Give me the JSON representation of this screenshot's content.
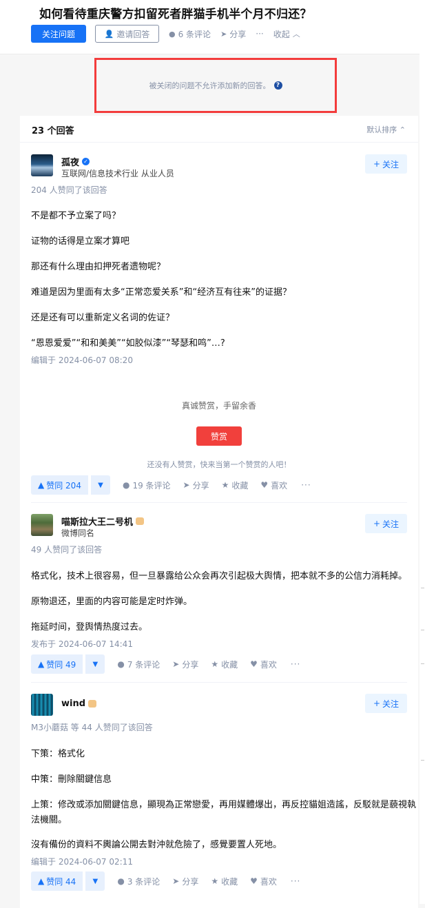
{
  "question": {
    "title": "如何看待重庆警方扣留死者胖猫手机半个月不归还？",
    "follow_label": "关注问题",
    "invite_label": "邀请回答",
    "comments_label": "6 条评论",
    "share_label": "分享",
    "more_label": "···",
    "collapse_label": "收起"
  },
  "closed_notice": {
    "text": "被关闭的问题不允许添加新的回答。",
    "help_glyph": "?"
  },
  "answers_header": {
    "count_label": "23 个回答",
    "sort_label": "默认排序"
  },
  "follow_label": "关注",
  "answers": [
    {
      "author": "孤夜",
      "bio": "互联网/信息技术行业 从业人员",
      "badge": "verified-icon",
      "votes_text": "204 人赞同了该回答",
      "paragraphs": [
        "不是都不予立案了吗？",
        "证物的话得是立案才算吧",
        "那还有什么理由扣押死者遗物呢？",
        "难道是因为里面有太多“正常恋爱关系”和“经济互有往来”的证据？",
        "还是还有可以重新定义名词的佐证？",
        "“恩恩爱爱”“和和美美”“如胶似漆”“琴瑟和鸣”…?"
      ],
      "time": "编辑于 2024-06-07 08:20",
      "reward": {
        "text": "真诚赞赏，手留余香",
        "button": "赞赏",
        "note": "还没有人赞赏，快来当第一个赞赏的人吧！"
      },
      "vote_label": "赞同 204",
      "comments": "19 条评论",
      "share": "分享",
      "favorite": "收藏",
      "like": "喜欢",
      "more": "···"
    },
    {
      "author": "喵斯拉大王二号机",
      "bio": "微博同名",
      "badge": "level-badge-icon",
      "votes_text": "49 人赞同了该回答",
      "paragraphs": [
        "格式化，技术上很容易，但一旦暴露给公众会再次引起极大舆情，把本就不多的公信力消耗掉。",
        "原物退还，里面的内容可能是定时炸弹。",
        "拖延时间，登舆情热度过去。"
      ],
      "time": "发布于 2024-06-07 14:41",
      "vote_label": "赞同 49",
      "comments": "7 条评论",
      "share": "分享",
      "favorite": "收藏",
      "like": "喜欢",
      "more": "···"
    },
    {
      "author": "wind",
      "bio": "",
      "badge": "level-badge-icon",
      "votes_text": "M3小蘑菇 等 44 人赞同了该回答",
      "paragraphs": [
        "下策：格式化",
        "中策：刪除關鍵信息",
        "上策：修改或添加關鍵信息，顯現為正常戀愛，再用媒體爆出，再反控貓姐造謠，反駁就是藐視執",
        "法機關。",
        "沒有備份的資料不輿論公開去對沖就危險了，感覺要置人死地。"
      ],
      "time": "编辑于 2024-06-07 02:11",
      "vote_label": "赞同 44",
      "comments": "3 条评论",
      "share": "分享",
      "favorite": "收藏",
      "like": "喜欢",
      "more": "···"
    }
  ]
}
